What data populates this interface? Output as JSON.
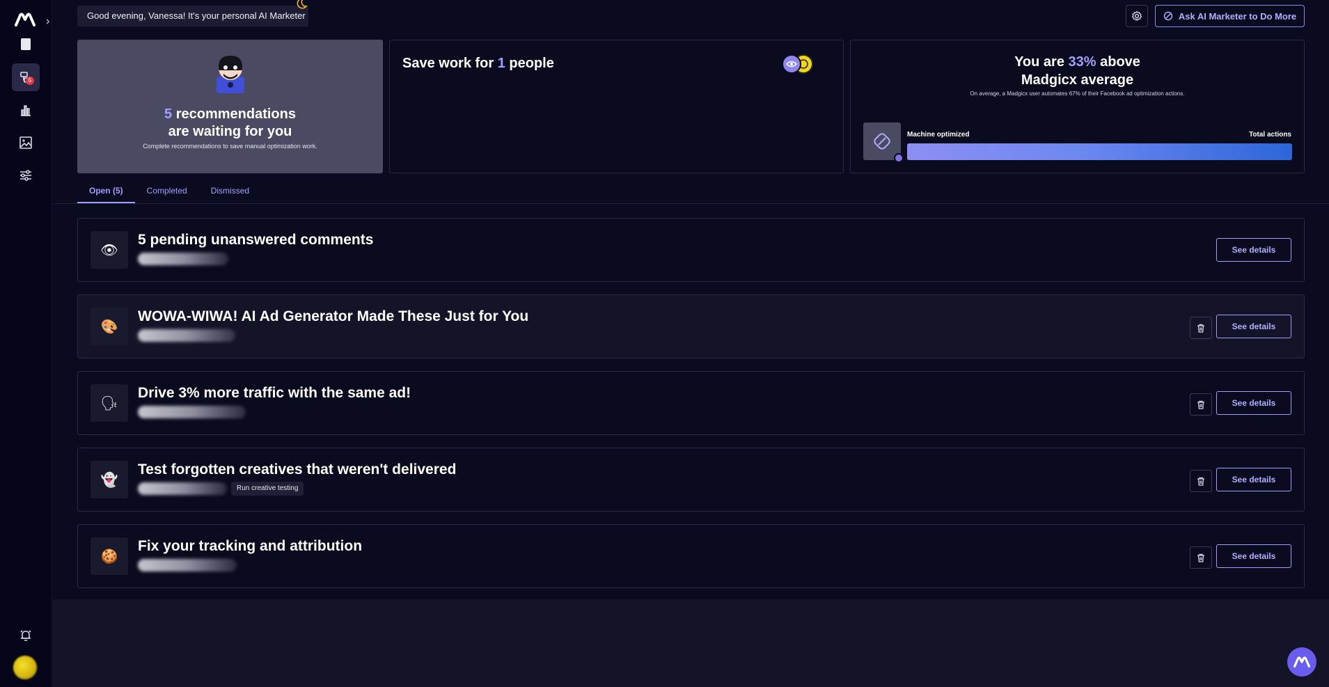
{
  "sidebar": {
    "recommendations_badge": "5"
  },
  "header": {
    "greeting": "Good evening, Vanessa! It's your personal AI Marketer",
    "ask_button_label": "Ask AI Marketer to Do More"
  },
  "cards": {
    "recommendations": {
      "count": "5",
      "line1_rest": " recommendations",
      "line2": "are waiting for you",
      "subtitle": "Complete recommendations to save manual optimization work."
    },
    "save_work": {
      "prefix": "Save work for ",
      "count": "1",
      "suffix": " people"
    },
    "average": {
      "prefix": "You are ",
      "percent": "33%",
      "suffix": " above",
      "line2": "Madgicx average",
      "subtitle": "On average, a Madgicx user automates 67% of their Facebook ad optimization actions.",
      "bar_left_label": "Machine optimized",
      "bar_right_label": "Total actions",
      "progress_fraction": 1.0
    }
  },
  "tabs": [
    {
      "label": "Open (5)",
      "active": true
    },
    {
      "label": "Completed",
      "active": false
    },
    {
      "label": "Dismissed",
      "active": false
    }
  ],
  "recommendations": [
    {
      "title": "5 pending unanswered comments",
      "icon": "👁",
      "chip": "",
      "dismissable": false
    },
    {
      "title": "WOWA-WIWA! AI Ad Generator Made These Just for You",
      "icon": "🎨",
      "chip": "",
      "dismissable": true
    },
    {
      "title": "Drive 3% more traffic with the same ad!",
      "icon": "🗣",
      "chip": "",
      "dismissable": true
    },
    {
      "title": "Test forgotten creatives that weren't delivered",
      "icon": "👻",
      "chip": "Run creative testing",
      "dismissable": true
    },
    {
      "title": "Fix your tracking and attribution",
      "icon": "🍪",
      "chip": "",
      "dismissable": true
    }
  ],
  "see_details_label": "See details",
  "colors": {
    "accent": "#a69cff",
    "background": "#0b0b1f",
    "sidebar": "#06061a",
    "card_highlight": "#4a4a63"
  }
}
